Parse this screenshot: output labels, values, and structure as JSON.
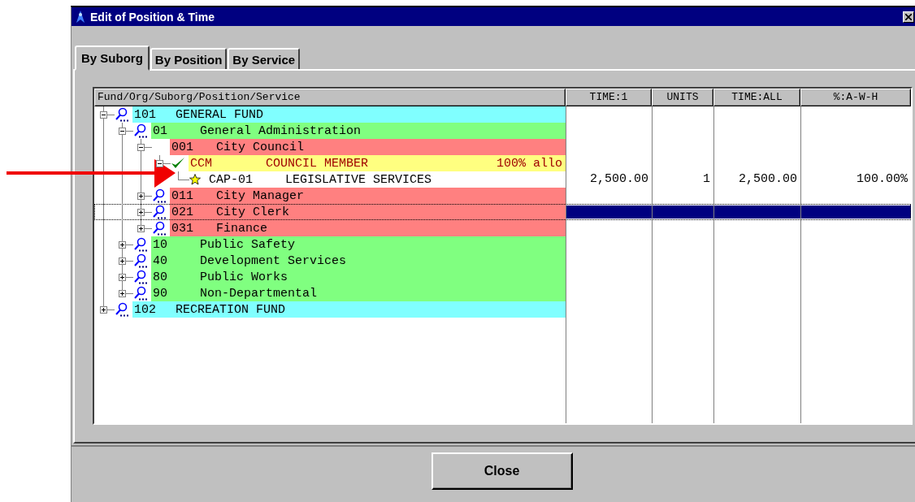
{
  "window": {
    "title": "Edit of Position & Time"
  },
  "tabs": [
    {
      "label": "By Suborg",
      "selected": true
    },
    {
      "label": "By Position",
      "selected": false
    },
    {
      "label": "By Service",
      "selected": false
    }
  ],
  "table": {
    "columns": [
      "Fund/Org/Suborg/Position/Service",
      "TIME:1",
      "UNITS",
      "TIME:ALL",
      "%:A-W-H"
    ],
    "tree": [
      {
        "code": "101",
        "name": "GENERAL FUND",
        "kind": "lookup",
        "color": "#80ffff",
        "expanded": true,
        "selected": false,
        "children": [
          {
            "code": "01",
            "name": "General Administration",
            "kind": "lookup",
            "color": "#80ff80",
            "expanded": true,
            "selected": false,
            "children": [
              {
                "code": "001",
                "name": "City Council",
                "kind": "none",
                "color": "#ff8080",
                "expanded": true,
                "selected": false,
                "children": [
                  {
                    "code": "CCM",
                    "name": "COUNCIL MEMBER",
                    "note": "100% allo",
                    "kind": "check",
                    "color": "#ffff80",
                    "expanded": true,
                    "selected": false,
                    "children": [
                      {
                        "code": "CAP-01",
                        "name": "LEGISLATIVE SERVICES",
                        "kind": "star",
                        "color": "#ffffff",
                        "selected": false,
                        "values": [
                          "2,500.00",
                          "1",
                          "2,500.00",
                          "100.00%"
                        ]
                      }
                    ]
                  }
                ]
              },
              {
                "code": "011",
                "name": "City Manager",
                "kind": "lookup",
                "color": "#ff8080",
                "expanded": false,
                "selected": false
              },
              {
                "code": "021",
                "name": "City Clerk",
                "kind": "lookup",
                "color": "#ff8080",
                "expanded": false,
                "selected": true
              },
              {
                "code": "031",
                "name": "Finance",
                "kind": "lookup",
                "color": "#ff8080",
                "expanded": false,
                "selected": false
              }
            ]
          },
          {
            "code": "10",
            "name": "Public Safety",
            "kind": "lookup",
            "color": "#80ff80",
            "expanded": false,
            "selected": false
          },
          {
            "code": "40",
            "name": "Development Services",
            "kind": "lookup",
            "color": "#80ff80",
            "expanded": false,
            "selected": false
          },
          {
            "code": "80",
            "name": "Public Works",
            "kind": "lookup",
            "color": "#80ff80",
            "expanded": false,
            "selected": false
          },
          {
            "code": "90",
            "name": "Non-Departmental",
            "kind": "lookup",
            "color": "#80ff80",
            "expanded": false,
            "selected": false
          }
        ]
      },
      {
        "code": "102",
        "name": "RECREATION FUND",
        "kind": "lookup",
        "color": "#80ffff",
        "expanded": false,
        "selected": false
      }
    ]
  },
  "buttons": [
    {
      "label": "Close"
    }
  ]
}
